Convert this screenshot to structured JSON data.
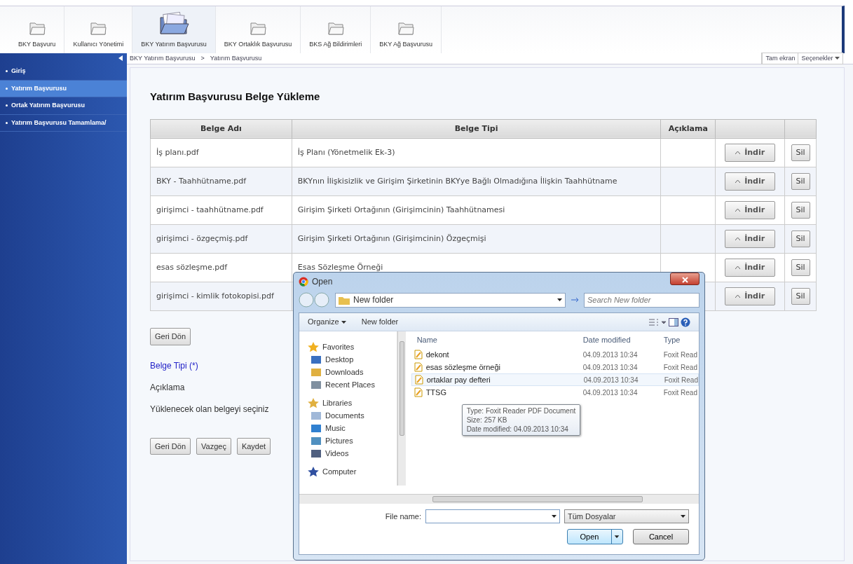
{
  "toolbar": {
    "items": [
      {
        "label": "BKY Başvuru",
        "selected": false
      },
      {
        "label": "Kullanıcı Yönetimi",
        "selected": false
      },
      {
        "label": "BKY Yatırım Başvurusu",
        "selected": true
      },
      {
        "label": "BKY Ortaklık Başvurusu",
        "selected": false
      },
      {
        "label": "BKS Ağ Bildirimleri",
        "selected": false
      },
      {
        "label": "BKY Ağ Başvurusu",
        "selected": false
      }
    ]
  },
  "sidebar": {
    "items": [
      {
        "label": "Giriş",
        "selected": false
      },
      {
        "label": "Yatırım Başvurusu",
        "selected": true
      },
      {
        "label": "Ortak Yatırım Başvurusu",
        "selected": false
      },
      {
        "label": "Yatırım Başvurusu Tamamlama/",
        "selected": false
      }
    ]
  },
  "breadcrumb": [
    "BKY Yatırım Başvurusu",
    ">",
    "Yatırım Başvurusu"
  ],
  "top_actions": {
    "fullscreen": "Tam ekran",
    "options": "Seçenekler"
  },
  "page_title": "Yatırım Başvurusu Belge Yükleme",
  "table": {
    "columns": [
      "Belge Adı",
      "Belge Tipi",
      "Açıklama"
    ],
    "rows": [
      {
        "name": "İş planı.pdf",
        "type": "İş Planı (Yönetmelik Ek-3)",
        "download": "İndir",
        "delete": "Sil"
      },
      {
        "name": "BKY - Taahhütname.pdf",
        "type": "BKYnın İlişkisizlik ve Girişim Şirketinin BKYye Bağlı Olmadığına İlişkin Taahhütname",
        "download": "İndir",
        "delete": "Sil"
      },
      {
        "name": "girişimci - taahhütname.pdf",
        "type": "Girişim Şirketi Ortağının (Girişimcinin) Taahhütnamesi",
        "download": "İndir",
        "delete": "Sil"
      },
      {
        "name": "girişimci - özgeçmiş.pdf",
        "type": "Girişim Şirketi Ortağının (Girişimcinin) Özgeçmişi",
        "download": "İndir",
        "delete": "Sil"
      },
      {
        "name": "esas sözleşme.pdf",
        "type": "Esas Sözleşme Örneği",
        "download": "İndir",
        "delete": "Sil"
      },
      {
        "name": "girişimci - kimlik fotokopisi.pdf",
        "download": "İndir",
        "delete": "Sil"
      }
    ]
  },
  "back_button": "Geri Dön",
  "form": {
    "labels": [
      {
        "text": "Belge Tipi (*)",
        "required": true
      },
      {
        "text": "Açıklama",
        "required": false
      },
      {
        "text": "Yüklenecek olan belgeyi seçiniz",
        "required": false
      }
    ],
    "buttons": [
      "Geri Dön",
      "Vazgeç",
      "Kaydet"
    ]
  },
  "dialog": {
    "title": "Open",
    "path": "New folder",
    "search_placeholder": "Search New folder",
    "toolbar": [
      "Organize",
      "New folder"
    ],
    "nav": [
      {
        "label": "Favorites",
        "kind": "header"
      },
      {
        "label": "Desktop",
        "kind": "item"
      },
      {
        "label": "Downloads",
        "kind": "item"
      },
      {
        "label": "Recent Places",
        "kind": "item"
      },
      {
        "label": "Libraries",
        "kind": "header"
      },
      {
        "label": "Documents",
        "kind": "item"
      },
      {
        "label": "Music",
        "kind": "item"
      },
      {
        "label": "Pictures",
        "kind": "item"
      },
      {
        "label": "Videos",
        "kind": "item"
      },
      {
        "label": "Computer",
        "kind": "header"
      }
    ],
    "columns": [
      "Name",
      "Date modified",
      "Type"
    ],
    "files": [
      {
        "name": "dekont",
        "date": "04.09.2013 10:34",
        "type": "Foxit Read",
        "hovered": false
      },
      {
        "name": "esas sözleşme örneği",
        "date": "04.09.2013 10:34",
        "type": "Foxit Read",
        "hovered": false
      },
      {
        "name": "ortaklar pay defteri",
        "date": "04.09.2013 10:34",
        "type": "Foxit Read",
        "hovered": true
      },
      {
        "name": "TTSG",
        "date": "04.09.2013 10:34",
        "type": "Foxit Read",
        "hovered": false
      }
    ],
    "tooltip": [
      "Type: Foxit Reader PDF Document",
      "Size: 257 KB",
      "Date modified: 04.09.2013 10:34"
    ],
    "file_name_label": "File name:",
    "filter": "Tüm Dosyalar",
    "open": "Open",
    "cancel": "Cancel"
  }
}
